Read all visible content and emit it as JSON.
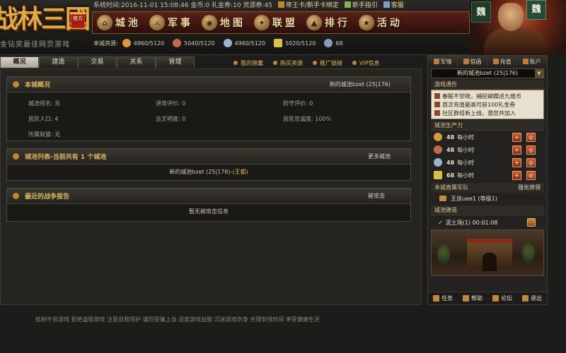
{
  "header": {
    "logo_text": "战林三國",
    "logo_seal": "官方",
    "slogan": "金钻奖最佳网页游戏",
    "server_time": "系统时间:2016-11-01 15:08:46",
    "gold": "金币:0",
    "gift_coupon": "礼金券:10",
    "resource_coupon": "资源券:45",
    "links": [
      "帝王卡/新手卡绑定",
      "新手指引",
      "客服"
    ],
    "nav": [
      "城池",
      "军事",
      "地图",
      "联盟",
      "排行",
      "活动"
    ],
    "resources_label": "本城资源:",
    "resources": [
      {
        "name": "food",
        "value": "4960/5120",
        "color": "#d89a3a"
      },
      {
        "name": "wood",
        "value": "5040/5120",
        "color": "#c06a4a"
      },
      {
        "name": "stone",
        "value": "4960/5120",
        "color": "#9ab4d0"
      },
      {
        "name": "iron",
        "value": "5020/5120",
        "color": "#d8c040"
      },
      {
        "name": "population",
        "value": "68",
        "color": "#8a9ab0"
      }
    ],
    "general_flag": "魏",
    "faction_badge": "魏"
  },
  "tabs": [
    {
      "label": "概况",
      "active": true
    },
    {
      "label": "建造",
      "active": false
    },
    {
      "label": "交易",
      "active": false
    },
    {
      "label": "关系",
      "active": false
    },
    {
      "label": "管理",
      "active": false
    }
  ],
  "top_links": [
    "我的锦囊",
    "购买资源",
    "推广链接",
    "VIP信息"
  ],
  "overview": {
    "title": "本城概况",
    "city": "新的城池bzet (25|176)",
    "rows": [
      [
        "城池排名: 无",
        "进攻评价: 0",
        "防守评价: 0"
      ],
      [
        "居民人口: 4",
        "总文明度: 0",
        "居民忠诚度: 100%"
      ],
      [
        "所属联盟: 无",
        "",
        ""
      ]
    ]
  },
  "city_list": {
    "title": "城池列表-当前共有 1 个城池",
    "more": "更多城池",
    "item_name": "新的城池bzet (25|176)-",
    "item_capital": "(王都)"
  },
  "war_report": {
    "title": "最近的战争报告",
    "attacked": "被攻击",
    "empty": "暂无被攻击信息"
  },
  "sidebar": {
    "tabs": [
      "军情",
      "信函",
      "充值",
      "账户"
    ],
    "city_name": "新的城池bzet (25|176)",
    "notice_title": "游戏通告",
    "notices": [
      "春眠不觉晓，捕捉蝴蝶送九维币",
      "首次充值最高可获100礼金券",
      "社区群组新上线，邀您共加入"
    ],
    "production_title": "城池生产力",
    "production": [
      {
        "value": "48",
        "unit": "每小时",
        "color": "#d89a3a"
      },
      {
        "value": "48",
        "unit": "每小时",
        "color": "#c06a4a"
      },
      {
        "value": "48",
        "unit": "每小时",
        "color": "#9ab4d0"
      },
      {
        "value": "68",
        "unit": "每小时",
        "color": "#d8c040"
      }
    ],
    "troops_title": "本城直属军队",
    "troops_train": "强化将领",
    "troop": "王良uee1 (等级1)",
    "build_title": "城池建造",
    "build_item": "泥土场(1) 00:01:08",
    "footer": [
      "任务",
      "帮助",
      "论坛",
      "退出"
    ]
  },
  "footer_text": "抵制不良游戏 拒绝盗版游戏 注意自我保护 谨防受骗上当 适度游戏益脑 沉迷游戏伤身 合理安排时间 享受健康生活"
}
